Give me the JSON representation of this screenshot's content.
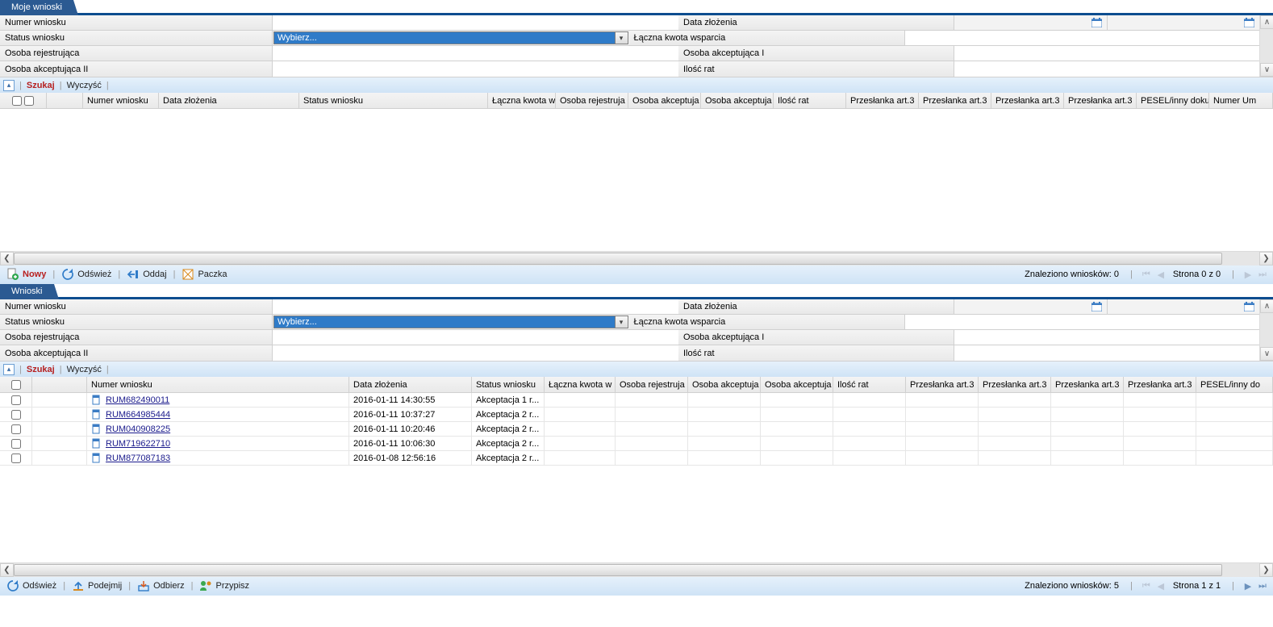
{
  "common": {
    "sep": "|",
    "selectPlaceholder": "Wybierz..."
  },
  "filterLabels": {
    "numer": "Numer wniosku",
    "status": "Status wniosku",
    "osobaRej": "Osoba rejestrująca",
    "osobaAkc2": "Osoba akceptująca II",
    "dataZl": "Data złożenia",
    "kwota": "Łączna kwota wsparcia",
    "osobaAkc1": "Osoba akceptująca I",
    "iloscRat": "Ilość rat"
  },
  "actions": {
    "szukaj": "Szukaj",
    "wyczysc": "Wyczyść"
  },
  "cols": {
    "numer": "Numer wniosku",
    "data": "Data złożenia",
    "status": "Status wniosku",
    "kwota": "Łączna kwota w",
    "osRej": "Osoba rejestruja",
    "osAkc": "Osoba akceptuja",
    "ilosc": "Ilość rat",
    "prz": "Przesłanka art.3",
    "pesel1": "PESEL/inny doku",
    "numerUm": "Numer Um",
    "pesel2": "PESEL/inny do"
  },
  "panel1": {
    "tabTitle": "Moje wnioski",
    "toolbar": {
      "nowy": "Nowy",
      "odswiez": "Odśwież",
      "oddaj": "Oddaj",
      "paczka": "Paczka"
    },
    "found": "Znaleziono wniosków: 0",
    "page": "Strona 0 z 0"
  },
  "panel2": {
    "tabTitle": "Wnioski",
    "toolbar": {
      "odswiez": "Odśwież",
      "podejmij": "Podejmij",
      "odbierz": "Odbierz",
      "przypisz": "Przypisz"
    },
    "found": "Znaleziono wniosków: 5",
    "page": "Strona 1 z 1",
    "rows": [
      {
        "numer": "RUM682490011",
        "data": "2016-01-11 14:30:55",
        "status": "Akceptacja 1 r..."
      },
      {
        "numer": "RUM664985444",
        "data": "2016-01-11 10:37:27",
        "status": "Akceptacja 2 r..."
      },
      {
        "numer": "RUM040908225",
        "data": "2016-01-11 10:20:46",
        "status": "Akceptacja 2 r..."
      },
      {
        "numer": "RUM719622710",
        "data": "2016-01-11 10:06:30",
        "status": "Akceptacja 2 r..."
      },
      {
        "numer": "RUM877087183",
        "data": "2016-01-08 12:56:16",
        "status": "Akceptacja 2 r..."
      }
    ]
  }
}
